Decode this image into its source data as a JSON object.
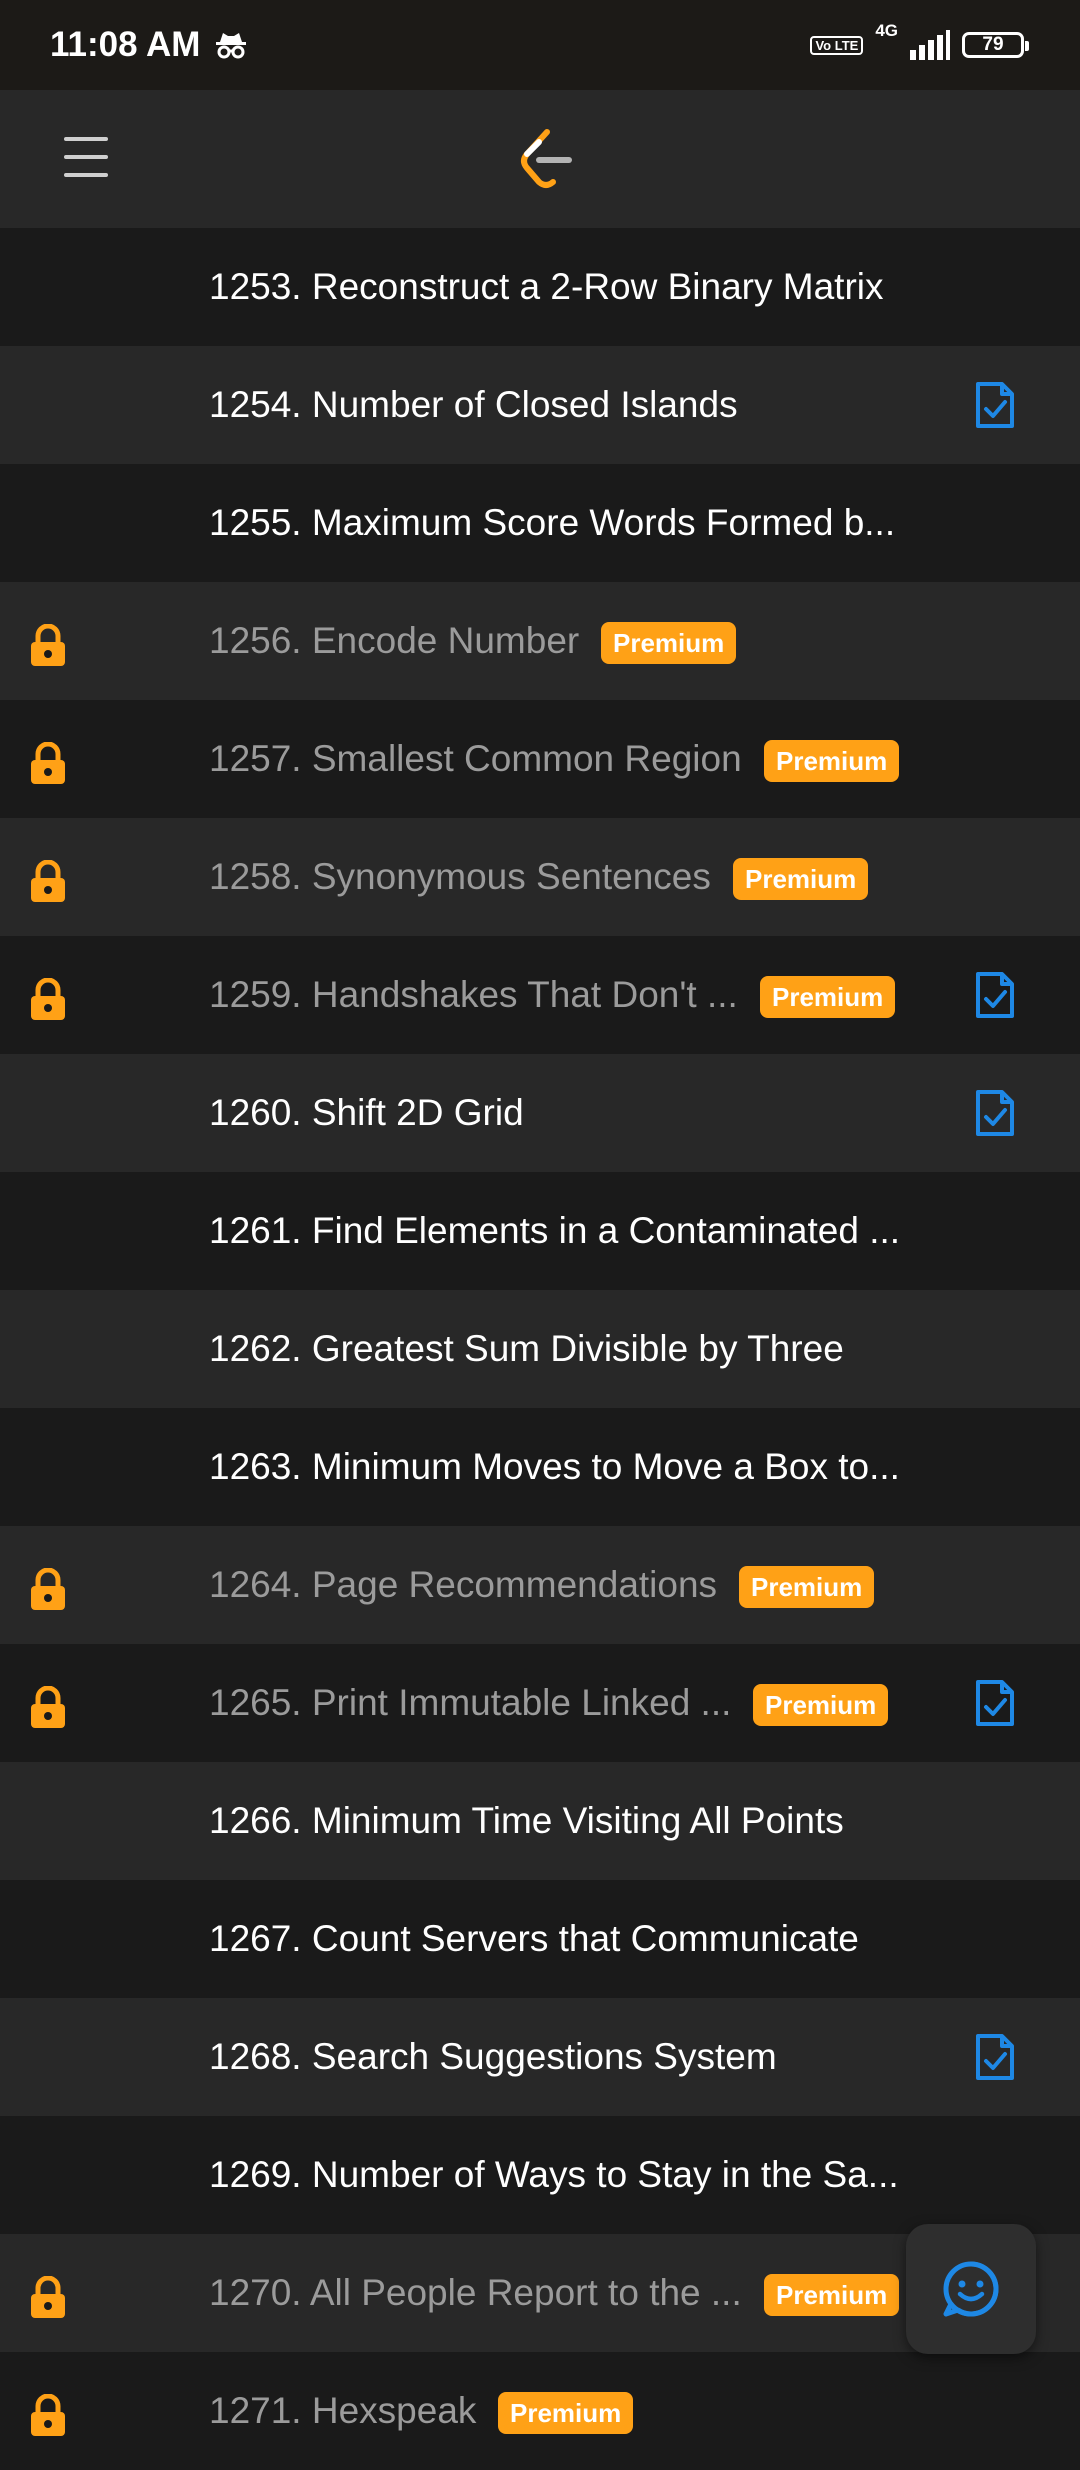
{
  "status_bar": {
    "time": "11:08 AM",
    "incognito_icon": "incognito-icon",
    "volte": "Vo LTE",
    "network": "4G",
    "battery": "79"
  },
  "nav": {
    "menu_icon": "hamburger-menu-icon",
    "logo_icon": "leetcode-logo-icon"
  },
  "premium_label": "Premium",
  "problems": [
    {
      "title": "1253. Reconstruct a 2-Row Binary Matrix",
      "locked": false,
      "premium": false,
      "solution": false
    },
    {
      "title": "1254. Number of Closed Islands",
      "locked": false,
      "premium": false,
      "solution": true
    },
    {
      "title": "1255. Maximum Score Words Formed b...",
      "locked": false,
      "premium": false,
      "solution": false
    },
    {
      "title": "1256. Encode Number",
      "locked": true,
      "premium": true,
      "solution": false
    },
    {
      "title": "1257. Smallest Common Region",
      "locked": true,
      "premium": true,
      "solution": false
    },
    {
      "title": "1258. Synonymous Sentences",
      "locked": true,
      "premium": true,
      "solution": false
    },
    {
      "title": "1259. Handshakes That Don't ...",
      "locked": true,
      "premium": true,
      "solution": true
    },
    {
      "title": "1260. Shift 2D Grid",
      "locked": false,
      "premium": false,
      "solution": true
    },
    {
      "title": "1261. Find Elements in a Contaminated ...",
      "locked": false,
      "premium": false,
      "solution": false
    },
    {
      "title": "1262. Greatest Sum Divisible by Three",
      "locked": false,
      "premium": false,
      "solution": false
    },
    {
      "title": "1263. Minimum Moves to Move a Box to...",
      "locked": false,
      "premium": false,
      "solution": false
    },
    {
      "title": "1264. Page Recommendations",
      "locked": true,
      "premium": true,
      "solution": false
    },
    {
      "title": "1265. Print Immutable Linked ...",
      "locked": true,
      "premium": true,
      "solution": true
    },
    {
      "title": "1266. Minimum Time Visiting All Points",
      "locked": false,
      "premium": false,
      "solution": false
    },
    {
      "title": "1267. Count Servers that Communicate",
      "locked": false,
      "premium": false,
      "solution": false
    },
    {
      "title": "1268. Search Suggestions System",
      "locked": false,
      "premium": false,
      "solution": true
    },
    {
      "title": "1269. Number of Ways to Stay in the Sa...",
      "locked": false,
      "premium": false,
      "solution": false
    },
    {
      "title": "1270. All People Report to the ...",
      "locked": true,
      "premium": true,
      "solution": false
    },
    {
      "title": "1271. Hexspeak",
      "locked": true,
      "premium": true,
      "solution": false
    }
  ],
  "fab_icon": "feedback-chat-icon",
  "colors": {
    "accent": "#ffa116",
    "solution_blue": "#1e88e5",
    "row_dark": "#1a1a1a",
    "row_light": "#282828"
  }
}
